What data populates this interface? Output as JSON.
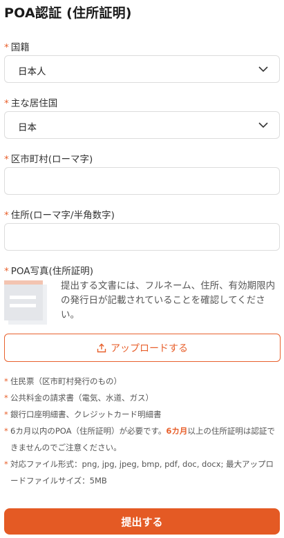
{
  "page": {
    "title": "POA認証 (住所証明)"
  },
  "required_mark": "*",
  "nationality": {
    "label": "国籍",
    "value": "日本人",
    "icon": "chevron-down-icon"
  },
  "residence": {
    "label": "主な居住国",
    "value": "日本",
    "icon": "chevron-down-icon"
  },
  "municipality": {
    "label": "区市町村(ローマ字)",
    "value": ""
  },
  "address": {
    "label": "住所(ローマ字/半角数字)",
    "value": ""
  },
  "poa_photo": {
    "label": "POA写真(住所証明)",
    "description": "提出する文書には、フルネーム、住所、有効期限内の発行日が記載されていることを確認してください。",
    "upload_label": "アップロードする",
    "upload_icon": "upload-icon"
  },
  "notes": [
    {
      "text": "住民票（区市町村発行のもの）"
    },
    {
      "text": "公共料金の請求書（電気、水道、ガス）"
    },
    {
      "text": "銀行口座明細書、クレジットカード明細書"
    },
    {
      "before": "6カ月以内のPOA（住所証明）が必要です。",
      "highlight": "6カ月",
      "after": "以上の住所証明は認証できませんのでご注意ください。"
    },
    {
      "text": "対応ファイル形式：png, jpg, jpeg, bmp, pdf, doc, docx; 最大アップロードファイルサイズ：5MB"
    }
  ],
  "submit": {
    "label": "提出する"
  },
  "colors": {
    "accent": "#e8602c",
    "submit_bg": "#e45a24",
    "border": "#dcdcdc"
  }
}
